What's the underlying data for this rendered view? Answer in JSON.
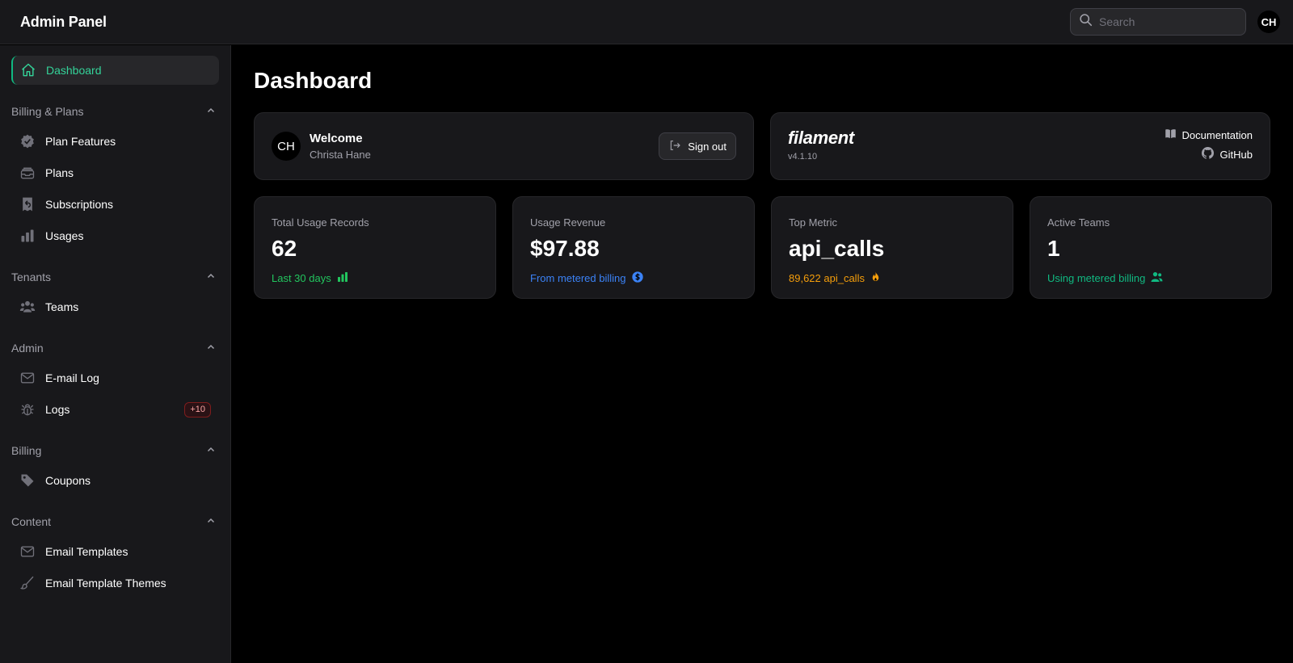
{
  "topbar": {
    "brand": "Admin Panel",
    "search_placeholder": "Search",
    "user_initials": "CH"
  },
  "sidebar": {
    "dashboard": {
      "label": "Dashboard",
      "icon": "home-icon"
    },
    "groups": [
      {
        "title": "Billing & Plans",
        "items": [
          {
            "label": "Plan Features",
            "icon": "badge-check-icon"
          },
          {
            "label": "Plans",
            "icon": "inbox-stack-icon"
          },
          {
            "label": "Subscriptions",
            "icon": "receipt-refund-icon"
          },
          {
            "label": "Usages",
            "icon": "chart-bar-icon"
          }
        ]
      },
      {
        "title": "Tenants",
        "items": [
          {
            "label": "Teams",
            "icon": "user-group-icon"
          }
        ]
      },
      {
        "title": "Admin",
        "items": [
          {
            "label": "E-mail Log",
            "icon": "envelope-icon"
          },
          {
            "label": "Logs",
            "icon": "bug-icon",
            "badge": "+10"
          }
        ]
      },
      {
        "title": "Billing",
        "items": [
          {
            "label": "Coupons",
            "icon": "tag-icon"
          }
        ]
      },
      {
        "title": "Content",
        "items": [
          {
            "label": "Email Templates",
            "icon": "envelope-icon"
          },
          {
            "label": "Email Template Themes",
            "icon": "paint-brush-icon"
          }
        ]
      }
    ]
  },
  "main": {
    "title": "Dashboard",
    "welcome": {
      "initials": "CH",
      "title": "Welcome",
      "name": "Christa Hane",
      "signout_label": "Sign out"
    },
    "filament": {
      "logo": "filament",
      "version": "v4.1.10",
      "documentation_label": "Documentation",
      "github_label": "GitHub"
    },
    "stats": [
      {
        "label": "Total Usage Records",
        "value": "62",
        "description": "Last 30 days",
        "color": "#22c55e",
        "icon": "chart-bar-icon"
      },
      {
        "label": "Usage Revenue",
        "value": "$97.88",
        "description": "From metered billing",
        "color": "#3b82f6",
        "icon": "currency-dollar-icon"
      },
      {
        "label": "Top Metric",
        "value": "api_calls",
        "description": "89,622 api_calls",
        "color": "#f59e0b",
        "icon": "fire-icon"
      },
      {
        "label": "Active Teams",
        "value": "1",
        "description": "Using metered billing",
        "color": "#10b981",
        "icon": "users-icon"
      }
    ]
  },
  "colors": {
    "accent": "#34d399",
    "background": "#000000",
    "panel": "#18181b"
  }
}
